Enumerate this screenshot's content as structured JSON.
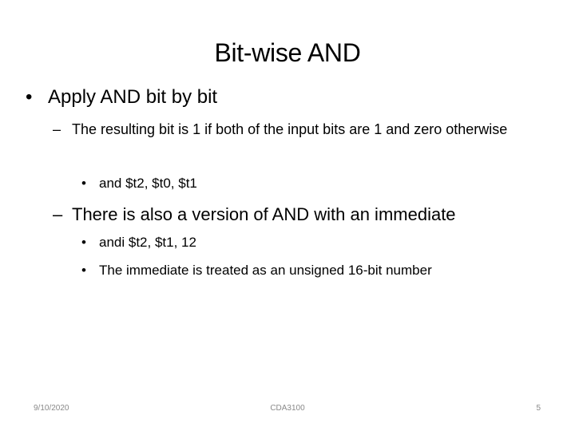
{
  "slide": {
    "title": "Bit-wise AND",
    "bullets": [
      {
        "marker": "•",
        "text": "Apply AND bit by bit",
        "children": [
          {
            "marker": "–",
            "text": "The resulting bit is 1 if both of the input bits are 1 and zero otherwise",
            "children": [
              {
                "marker": "•",
                "text": "and $t2, $t0, $t1"
              }
            ]
          },
          {
            "marker": "–",
            "text": "There is also a version of AND with an immediate",
            "children": [
              {
                "marker": "•",
                "text": "andi $t2,  $t1, 12"
              },
              {
                "marker": "•",
                "text": "The immediate is treated as an unsigned 16-bit number"
              }
            ]
          }
        ]
      }
    ]
  },
  "footer": {
    "date": "9/10/2020",
    "course": "CDA3100",
    "page_number": "5"
  }
}
